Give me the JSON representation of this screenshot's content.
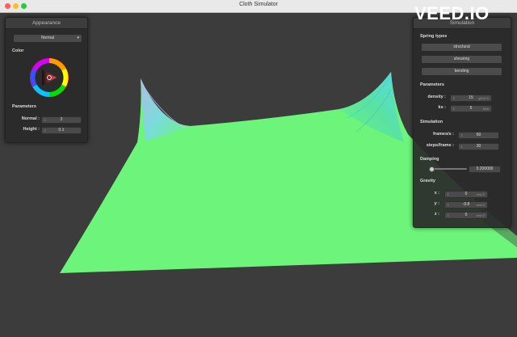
{
  "window": {
    "title": "Cloth Simulator"
  },
  "watermark": "VEED.IO",
  "left_panel": {
    "title": "Appearance",
    "shader_select": "Normal",
    "color_label": "Color",
    "params_label": "Parameters",
    "normal_label": "Normal :",
    "normal_value": "2",
    "height_label": "Height :",
    "height_value": "0.1"
  },
  "right_panel": {
    "title": "Simulation",
    "spring_label": "Spring types",
    "spring_buttons": [
      "structural",
      "shearing",
      "bending"
    ],
    "params_label": "Parameters",
    "density_label": "density :",
    "density_value": "15",
    "density_unit": "g/cm^2",
    "ks_label": "ks :",
    "ks_value": "5",
    "ks_unit": "N/m",
    "sim_label": "Simulation",
    "fps_label": "frames/s :",
    "fps_value": "60",
    "steps_label": "steps/frame :",
    "steps_value": "30",
    "damping_label": "Damping",
    "damping_value": "0.200000",
    "damping_level": 0.2,
    "gravity_label": "Gravity",
    "gx_label": "x :",
    "gx_value": "0",
    "gy_label": "y :",
    "gy_value": "-9.8",
    "gz_label": "z :",
    "gz_value": "0",
    "gravity_unit": "m/s^2"
  },
  "colors": {
    "cloth": "#6cf57a",
    "cloth_edge": "#43e06e",
    "ripple": "#6fd8d0",
    "background": "#3c3c3c"
  }
}
